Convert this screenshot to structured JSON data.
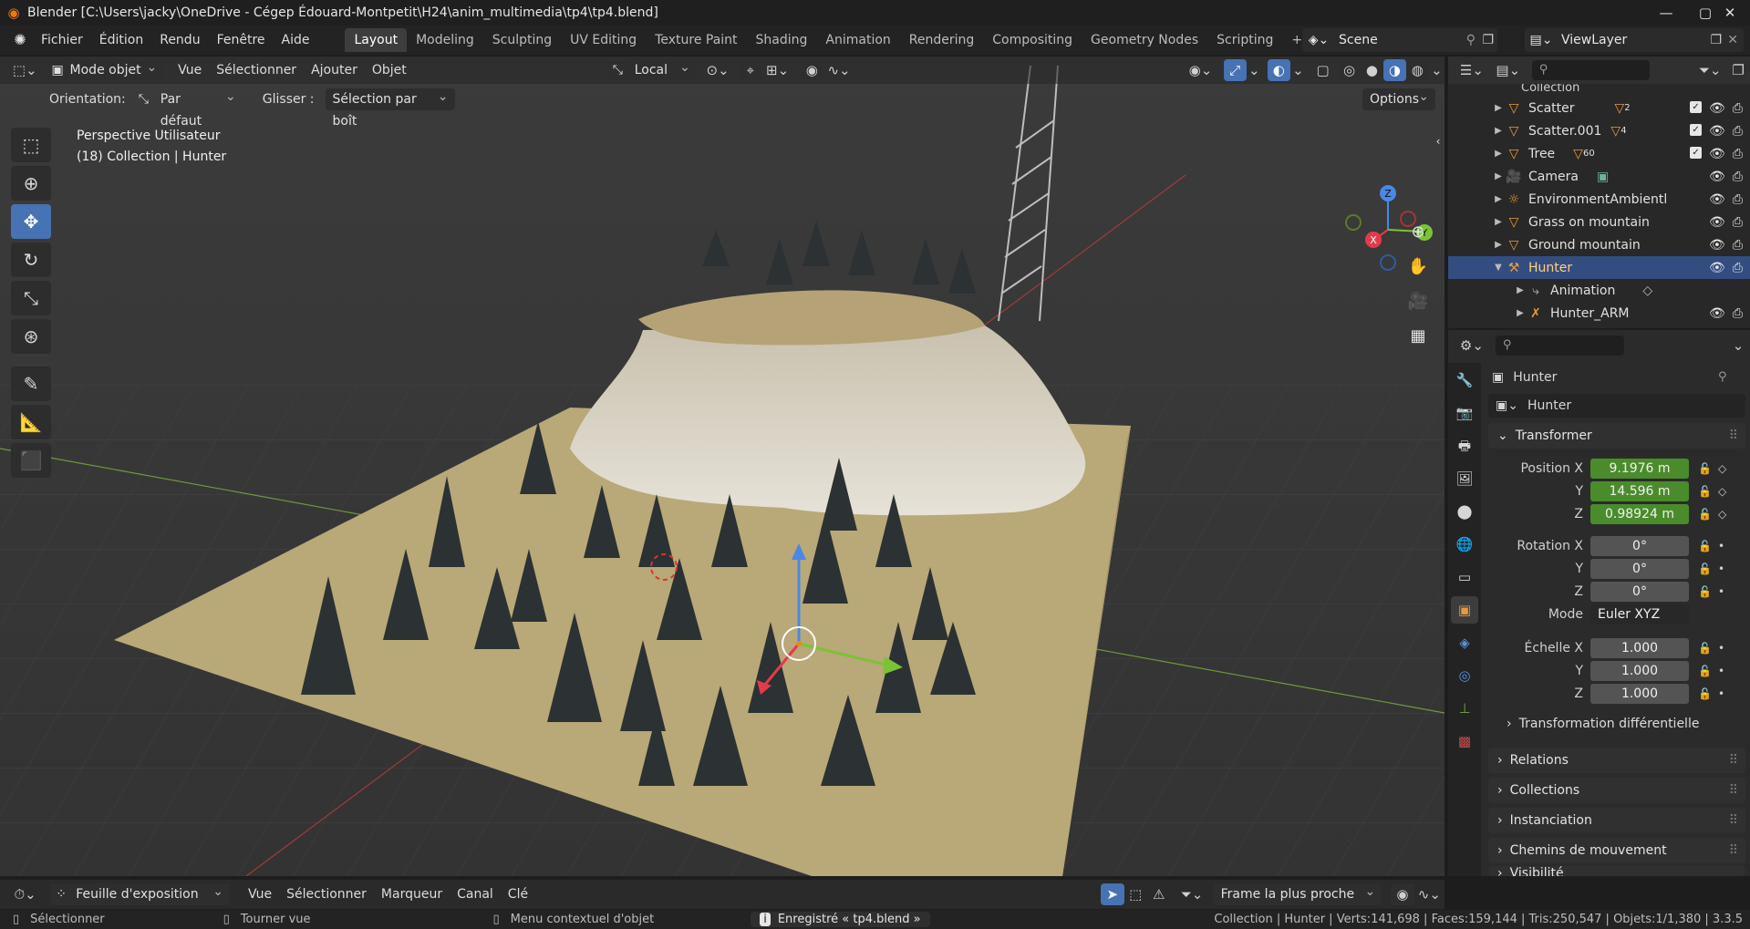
{
  "window": {
    "title": "Blender [C:\\Users\\jacky\\OneDrive - Cégep Édouard-Montpetit\\H24\\anim_multimedia\\tp4\\tp4.blend]",
    "minimize": "—",
    "maximize": "▢",
    "close": "✕"
  },
  "menu": [
    "Fichier",
    "Édition",
    "Rendu",
    "Fenêtre",
    "Aide"
  ],
  "workspaces": [
    "Layout",
    "Modeling",
    "Sculpting",
    "UV Editing",
    "Texture Paint",
    "Shading",
    "Animation",
    "Rendering",
    "Compositing",
    "Geometry Nodes",
    "Scripting"
  ],
  "add_workspace": "+",
  "scene": "Scene",
  "view_layer": "ViewLayer",
  "viewport": {
    "mode": "Mode objet",
    "menus": [
      "Vue",
      "Sélectionner",
      "Ajouter",
      "Objet"
    ],
    "transform_space": "Local",
    "orientation_label": "Orientation:",
    "orientation_value": "Par défaut",
    "drag_label": "Glisser :",
    "drag_value": "Sélection par boît",
    "options": "Options",
    "view_name": "Perspective Utilisateur",
    "view_context": "(18) Collection | Hunter"
  },
  "gizmo": {
    "x": "X",
    "y": "Y",
    "z": "Z"
  },
  "outliner": {
    "partial_top": "Collection",
    "rows": [
      {
        "name": "Scatter",
        "badge": "2",
        "checked": true
      },
      {
        "name": "Scatter.001",
        "badge": "4",
        "checked": true
      },
      {
        "name": "Tree",
        "badge": "60",
        "checked": true
      },
      {
        "name": "Camera",
        "badge": "",
        "checked": false
      },
      {
        "name": "EnvironmentAmbientl",
        "badge": "",
        "checked": false
      },
      {
        "name": "Grass on mountain",
        "badge": "",
        "checked": false
      },
      {
        "name": "Ground mountain",
        "badge": "",
        "checked": false
      },
      {
        "name": "Hunter",
        "badge": "",
        "checked": false
      },
      {
        "name": "Animation",
        "badge": "",
        "checked": false
      },
      {
        "name": "Hunter_ARM",
        "badge": "",
        "checked": false
      }
    ]
  },
  "properties": {
    "object_name": "Hunter",
    "datablock": "Hunter",
    "transform_panel": "Transformer",
    "location_label": "Position X",
    "location": [
      "9.1976 m",
      "14.596 m",
      "0.98924 m"
    ],
    "rotation_label": "Rotation X",
    "rotation": [
      "0°",
      "0°",
      "0°"
    ],
    "mode_label": "Mode",
    "rotation_mode": "Euler XYZ",
    "scale_label": "Échelle X",
    "scale": [
      "1.000",
      "1.000",
      "1.000"
    ],
    "axis_y": "Y",
    "axis_z": "Z",
    "delta": "Transformation différentielle",
    "panels": [
      "Relations",
      "Collections",
      "Instanciation",
      "Chemins de mouvement",
      "Visibilité"
    ]
  },
  "timeline": {
    "editor": "Feuille d'exposition",
    "menus": [
      "Vue",
      "Sélectionner",
      "Marqueur",
      "Canal",
      "Clé"
    ],
    "snap": "Frame la plus proche"
  },
  "status": {
    "left_select": "Sélectionner",
    "middle_rotate": "Tourner vue",
    "right_context": "Menu contextuel d'objet",
    "saved": "Enregistré « tp4.blend »",
    "stats": "Collection | Hunter | Verts:141,698 | Faces:159,144 | Tris:250,547 | Objets:1/1,380 | 3.3.5"
  }
}
